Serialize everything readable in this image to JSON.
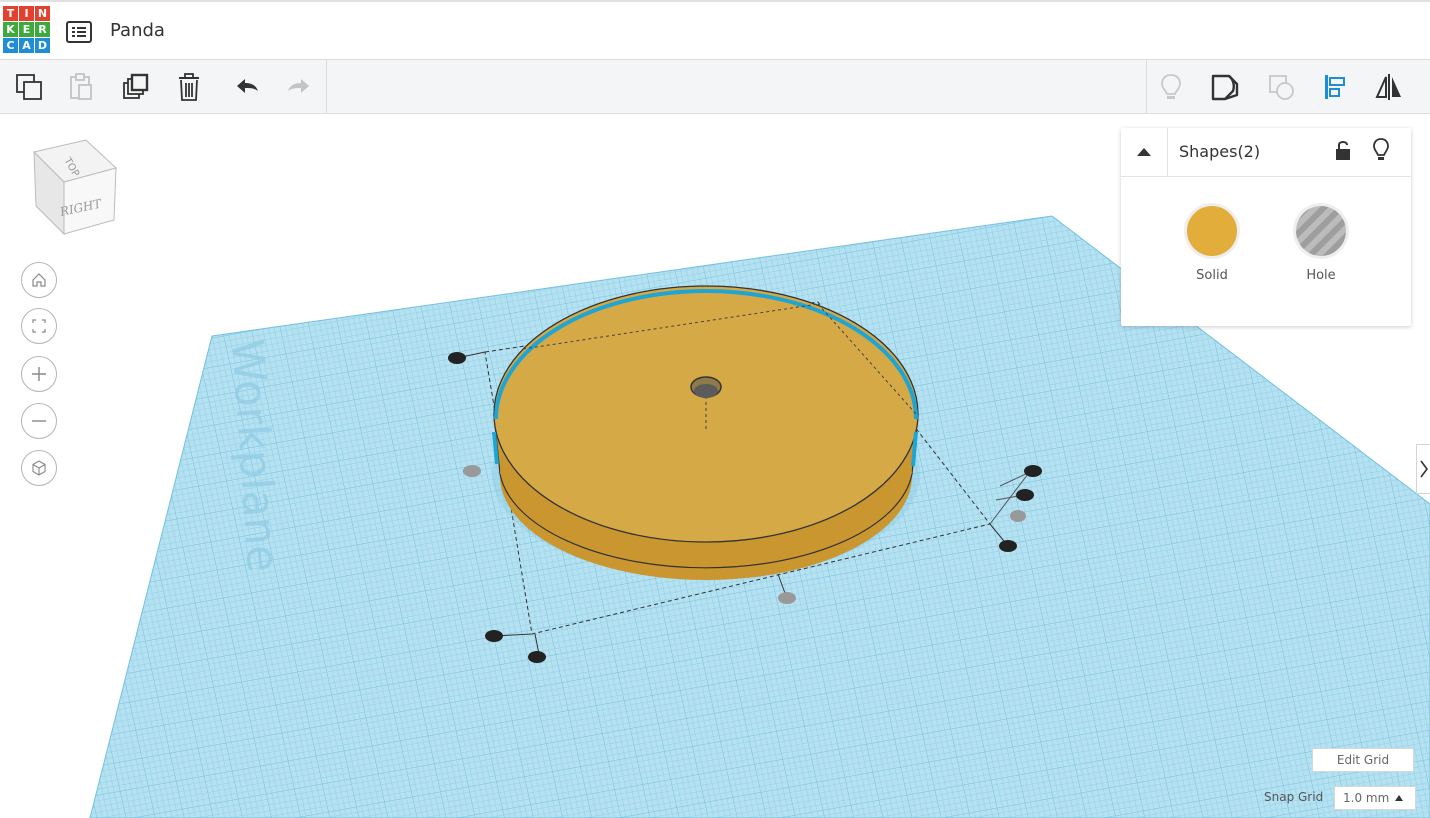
{
  "app": {
    "logo_letters": [
      "T",
      "I",
      "N",
      "K",
      "E",
      "R",
      "C",
      "A",
      "D"
    ],
    "logo_colors": [
      "#e2412f",
      "#e2412f",
      "#e2412f",
      "#3eaa3d",
      "#3eaa3d",
      "#3eaa3d",
      "#1f8ed6",
      "#1f8ed6",
      "#1f8ed6"
    ],
    "project_name": "Panda"
  },
  "toolbar": {
    "left_icons": [
      "copy-icon",
      "paste-icon",
      "duplicate-icon",
      "delete-icon",
      "undo-icon",
      "redo-icon"
    ],
    "right_icons": [
      "light-bulb-icon",
      "note-icon",
      "group-icon",
      "align-icon",
      "mirror-icon"
    ]
  },
  "viewcube": {
    "top_label": "TOP",
    "right_label": "RIGHT"
  },
  "nav_buttons": [
    "home-icon",
    "fit-icon",
    "zoom-in-icon",
    "zoom-out-icon",
    "ortho-icon"
  ],
  "workplane": {
    "label": "Workplane",
    "color": "#aee0f0",
    "grid_color": "#6fc1e0"
  },
  "shape": {
    "type": "cylinder",
    "color": "#e2ad3b"
  },
  "shapes_panel": {
    "title": "Shapes(2)",
    "solid_label": "Solid",
    "hole_label": "Hole",
    "solid_color": "#e2ad3b"
  },
  "bottom": {
    "edit_grid_label": "Edit Grid",
    "snap_grid_label": "Snap Grid",
    "snap_value": "1.0 mm"
  }
}
